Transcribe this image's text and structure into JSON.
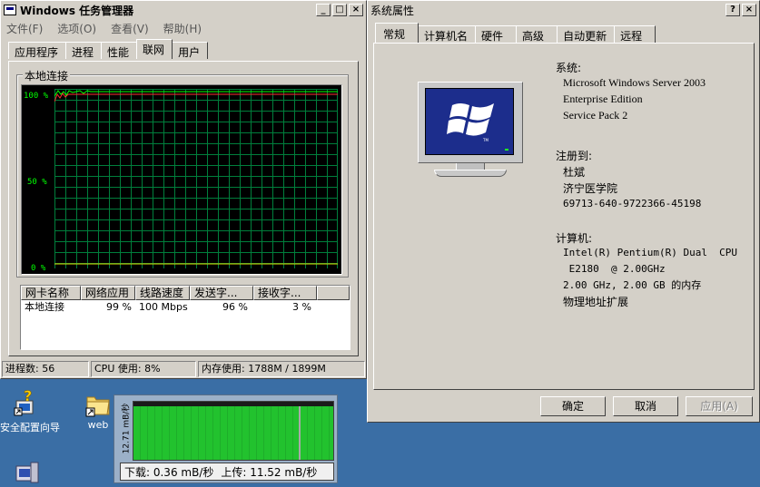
{
  "taskmgr": {
    "title": "Windows 任务管理器",
    "menu": [
      "文件(F)",
      "选项(O)",
      "查看(V)",
      "帮助(H)"
    ],
    "tabs": [
      "应用程序",
      "进程",
      "性能",
      "联网",
      "用户"
    ],
    "active_tab": "联网",
    "group_label": "本地连接",
    "y_labels": [
      "100 %",
      "50 %",
      "0 %"
    ],
    "list": {
      "columns": [
        "网卡名称",
        "网络应用",
        "线路速度",
        "发送字...",
        "接收字..."
      ],
      "rows": [
        [
          "本地连接",
          "99 %",
          "100 Mbps",
          "96 %",
          "3 %"
        ]
      ]
    },
    "status": {
      "processes": "进程数: 56",
      "cpu": "CPU 使用: 8%",
      "memory": "内存使用: 1788M / 1899M"
    }
  },
  "sysprops": {
    "title": "系统属性",
    "tabs": [
      "常规",
      "计算机名",
      "硬件",
      "高级",
      "自动更新",
      "远程"
    ],
    "active_tab": "常规",
    "system_label": "系统:",
    "os_lines": [
      "Microsoft Windows Server 2003",
      "Enterprise Edition",
      "Service Pack 2"
    ],
    "registered_label": "注册到:",
    "registered_lines": [
      "杜斌",
      "济宁医学院",
      "69713-640-9722366-45198"
    ],
    "computer_label": "计算机:",
    "computer_lines": [
      "Intel(R) Pentium(R) Dual  CPU",
      " E2180  @ 2.00GHz",
      "2.00 GHz, 2.00 GB 的内存",
      "物理地址扩展"
    ],
    "buttons": {
      "ok": "确定",
      "cancel": "取消",
      "apply": "应用(A)"
    }
  },
  "desktop": {
    "icons": [
      {
        "label": "安全配置向导",
        "icon": "security-wizard-icon"
      },
      {
        "label": "web",
        "icon": "folder-shortcut-icon"
      }
    ]
  },
  "netmeter": {
    "scale": "12.71 mB/秒",
    "download": "下载: 0.36 mB/秒",
    "upload": "上传: 11.52 mB/秒",
    "bar_color": "#22c22e"
  }
}
